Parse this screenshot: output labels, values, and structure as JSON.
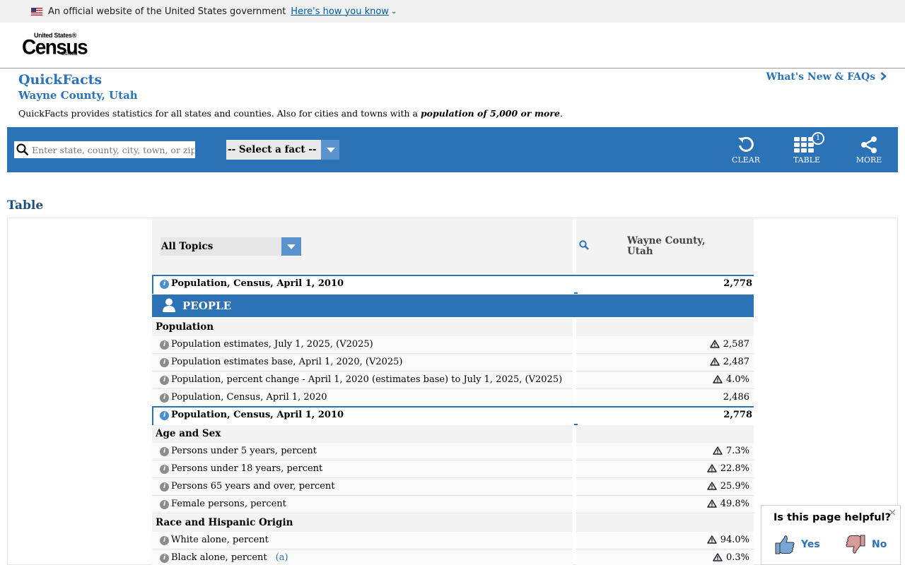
{
  "gov_banner": {
    "text": "An official website of the United States government",
    "link": "Here's how you know"
  },
  "logo": {
    "line1": "United States®",
    "line2": "Census",
    "line3": "Bureau"
  },
  "quickfacts": {
    "title": "QuickFacts",
    "subtitle": "Wayne County, Utah",
    "description_prefix": "QuickFacts provides statistics for all states and counties. Also for cities and towns with a ",
    "description_bold": "population of 5,000 or more",
    "description_suffix": ".",
    "whats_new": "What's New & FAQs"
  },
  "toolbar": {
    "search_placeholder": "Enter state, county, city, town, or zip code",
    "select_fact": "-- Select a fact --",
    "clear_label": "CLEAR",
    "table_label": "TABLE",
    "table_badge": "1",
    "more_label": "MORE"
  },
  "table": {
    "heading": "Table",
    "topics_select": "All Topics",
    "column_line1": "Wayne County,",
    "column_line2": "Utah",
    "pinned_row": {
      "label": "Population, Census, April 1, 2010",
      "value": "2,778"
    },
    "people_label": "PEOPLE",
    "sections": [
      {
        "title": "Population",
        "rows": [
          {
            "label": "Population estimates, July 1, 2025, (V2025)",
            "value": "2,587",
            "warn": true
          },
          {
            "label": "Population estimates base, April 1, 2020, (V2025)",
            "value": "2,487",
            "warn": true
          },
          {
            "label": "Population, percent change - April 1, 2020 (estimates base) to July 1, 2025, (V2025)",
            "value": "4.0%",
            "warn": true
          },
          {
            "label": "Population, Census, April 1, 2020",
            "value": "2,486",
            "warn": false
          },
          {
            "label": "Population, Census, April 1, 2010",
            "value": "2,778",
            "warn": false,
            "highlight": true
          }
        ]
      },
      {
        "title": "Age and Sex",
        "rows": [
          {
            "label": "Persons under 5 years, percent",
            "value": "7.3%",
            "warn": true
          },
          {
            "label": "Persons under 18 years, percent",
            "value": "22.8%",
            "warn": true
          },
          {
            "label": "Persons 65 years and over, percent",
            "value": "25.9%",
            "warn": true
          },
          {
            "label": "Female persons, percent",
            "value": "49.8%",
            "warn": true
          }
        ]
      },
      {
        "title": "Race and Hispanic Origin",
        "rows": [
          {
            "label": "White alone, percent",
            "value": "94.0%",
            "warn": true
          },
          {
            "label": "Black alone, percent",
            "value": "0.3%",
            "warn": true,
            "footnote": "(a)"
          }
        ]
      }
    ]
  },
  "feedback": {
    "question": "Is this page helpful?",
    "yes": "Yes",
    "no": "No",
    "close": "×"
  },
  "colors": {
    "accent": "#2b72b6",
    "banner_bg": "#f0f0f0",
    "row_bg": "#fafafa",
    "section_bg": "#f3f3f3"
  },
  "icons": [
    "us-flag-icon",
    "chevron-down-icon",
    "chevron-right-icon",
    "search-icon",
    "refresh-icon",
    "table-grid-icon",
    "share-icon",
    "info-icon",
    "warning-triangle-icon",
    "person-icon",
    "thumbs-up-icon",
    "thumbs-down-icon",
    "close-icon"
  ]
}
